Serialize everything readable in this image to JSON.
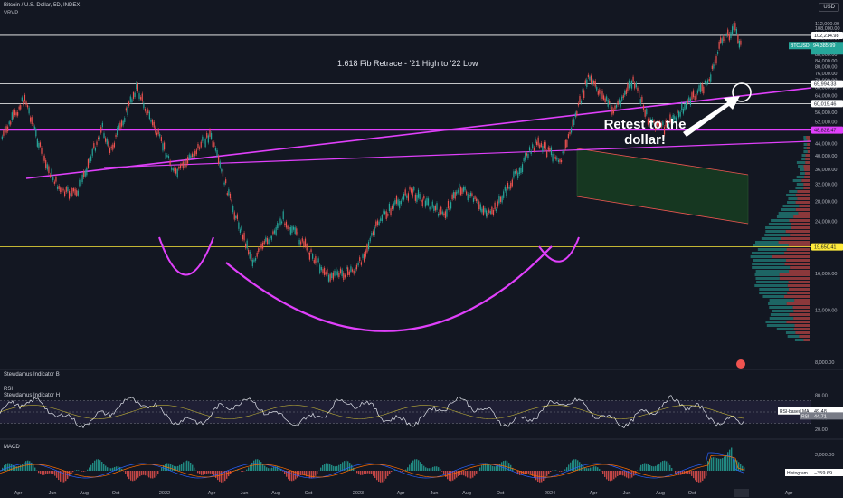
{
  "header": {
    "title": "Bitcoin / U.S. Dollar, 5D, INDEX",
    "indicator": "VRVP",
    "currency": "USD"
  },
  "chart_data": {
    "type": "line",
    "symbol": "BTCUSD",
    "price_axis": {
      "scale": "log",
      "ticks": [
        "112,000.00",
        "108,000.00",
        "104,000.00",
        "100,000.00",
        "96,000.00",
        "88,000.00",
        "84,000.00",
        "80,000.00",
        "76,000.00",
        "72,000.00",
        "68,000.00",
        "64,000.00",
        "56,000.00",
        "52,000.00",
        "44,000.00",
        "40,000.00",
        "36,000.00",
        "32,000.00",
        "28,000.00",
        "24,000.00",
        "16,000.00",
        "12,000.00",
        "8,000.00"
      ],
      "tick_values": [
        112000,
        108000,
        104000,
        100000,
        96000,
        88000,
        84000,
        80000,
        76000,
        72000,
        68000,
        64000,
        56000,
        52000,
        44000,
        40000,
        36000,
        32000,
        28000,
        24000,
        16000,
        12000,
        8000
      ]
    },
    "time_axis": [
      "Apr",
      "Jun",
      "Aug",
      "Oct",
      "2022",
      "Apr",
      "Jun",
      "Aug",
      "Oct",
      "2023",
      "Apr",
      "Jun",
      "Aug",
      "Oct",
      "2024",
      "Apr",
      "Jun",
      "Aug",
      "Oct",
      "2025",
      "Apr"
    ],
    "price_levels": [
      {
        "label": "102,214.98",
        "value": 102214.98,
        "color": "#ffffff"
      },
      {
        "label": "69,994.33",
        "value": 69994.33,
        "color": "#ffffff"
      },
      {
        "label": "60,019.46",
        "value": 60019.46,
        "color": "#ffffff"
      },
      {
        "label": "48,828.47",
        "value": 48828.47,
        "color": "#e040fb"
      },
      {
        "label": "19,650.41",
        "value": 19650.41,
        "color": "#ffeb3b"
      }
    ],
    "current_price": {
      "symbol": "BTCUSD",
      "value": "94,385.99",
      "color": "#26a69a"
    },
    "price_series": [
      [
        "2021-03-01",
        46000
      ],
      [
        "2021-04-13",
        63000
      ],
      [
        "2021-05-20",
        38000
      ],
      [
        "2021-06-22",
        30000
      ],
      [
        "2021-07-20",
        29800
      ],
      [
        "2021-09-07",
        50000
      ],
      [
        "2021-09-21",
        41000
      ],
      [
        "2021-11-10",
        68000
      ],
      [
        "2022-01-24",
        34500
      ],
      [
        "2022-03-29",
        47400
      ],
      [
        "2022-05-12",
        26500
      ],
      [
        "2022-06-18",
        17600
      ],
      [
        "2022-08-15",
        24500
      ],
      [
        "2022-11-09",
        15600
      ],
      [
        "2023-01-01",
        16500
      ],
      [
        "2023-02-15",
        24500
      ],
      [
        "2023-04-14",
        30500
      ],
      [
        "2023-06-15",
        25000
      ],
      [
        "2023-07-14",
        31500
      ],
      [
        "2023-09-11",
        25000
      ],
      [
        "2023-12-05",
        44000
      ],
      [
        "2024-01-23",
        39000
      ],
      [
        "2024-03-14",
        73500
      ],
      [
        "2024-05-01",
        57000
      ],
      [
        "2024-06-07",
        71500
      ],
      [
        "2024-07-05",
        53500
      ],
      [
        "2024-08-05",
        49500
      ],
      [
        "2024-10-29",
        72000
      ],
      [
        "2024-11-22",
        99000
      ],
      [
        "2024-12-17",
        108000
      ],
      [
        "2024-12-30",
        92000
      ]
    ],
    "annotations": {
      "fib_note": "1.618 Fib Retrace - '21 High to '22 Low",
      "callout": "Retest to the dollar!"
    },
    "indicators": {
      "pane1": {
        "name": "Stewdamus Indicator B"
      },
      "pane2": {
        "names": [
          "RSI",
          "Stewdamus Indicator H"
        ],
        "ticks": [
          "80.00",
          "40.00",
          "20.00"
        ],
        "rsi_ma_label": "RSI-based MA",
        "rsi_ma_value": "49.48",
        "rsi_label": "RSI",
        "rsi_value": "44.71"
      },
      "pane3": {
        "name": "MACD",
        "ticks": [
          "2,000.00",
          "0.00"
        ],
        "histogram_label": "Histogram",
        "histogram_value": "−359.69"
      }
    }
  }
}
